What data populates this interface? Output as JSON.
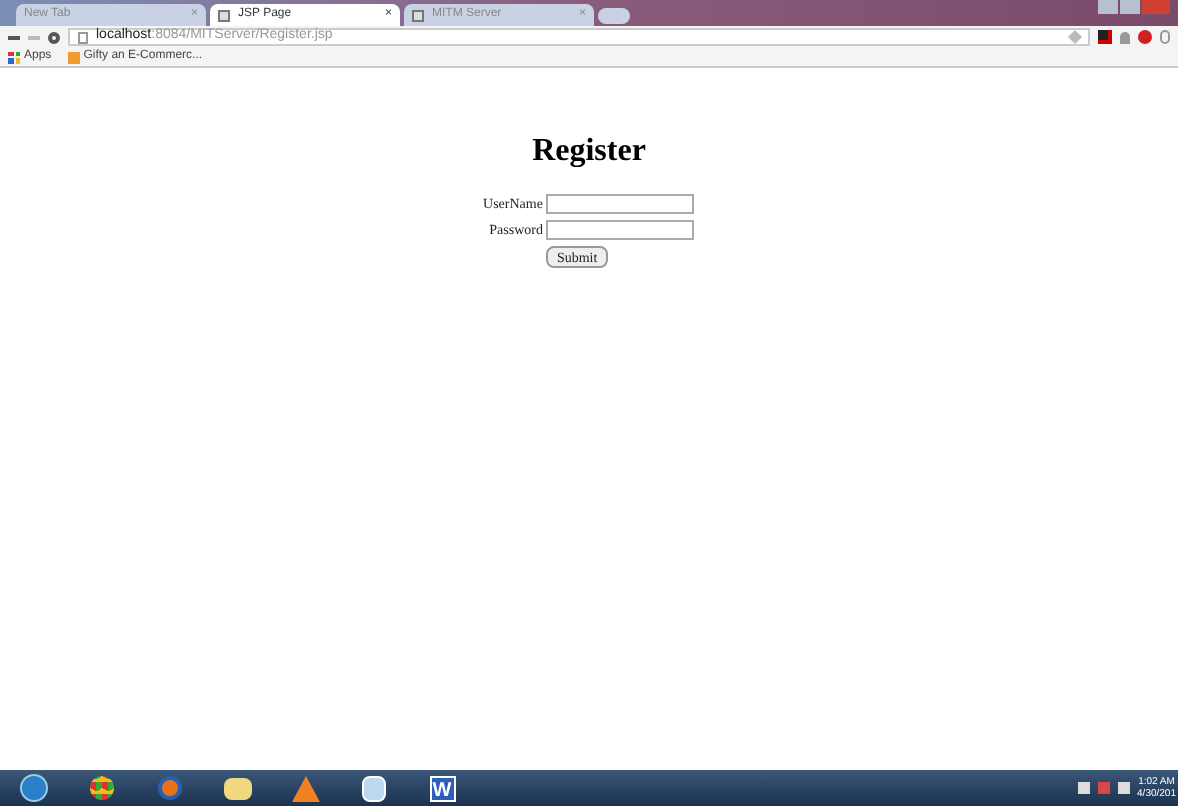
{
  "tabs": [
    {
      "title": "New Tab",
      "close": "×",
      "selected": false
    },
    {
      "title": "JSP Page",
      "close": "×",
      "selected": true
    },
    {
      "title": "MITM Server",
      "close": "×",
      "selected": false
    }
  ],
  "address": {
    "host": "localhost",
    "path": ":8084/MITServer/Register.jsp"
  },
  "bookmarks": [
    {
      "label": "Apps",
      "kind": "apps"
    },
    {
      "label": "Gifty an E-Commerc...",
      "kind": "page"
    }
  ],
  "page": {
    "heading": "Register",
    "fields": [
      {
        "label": "UserName"
      },
      {
        "label": "Password"
      }
    ],
    "submit": "Submit"
  },
  "taskbar": {
    "word_letter": "W",
    "time": "1:02 AM",
    "date": "4/30/201"
  }
}
